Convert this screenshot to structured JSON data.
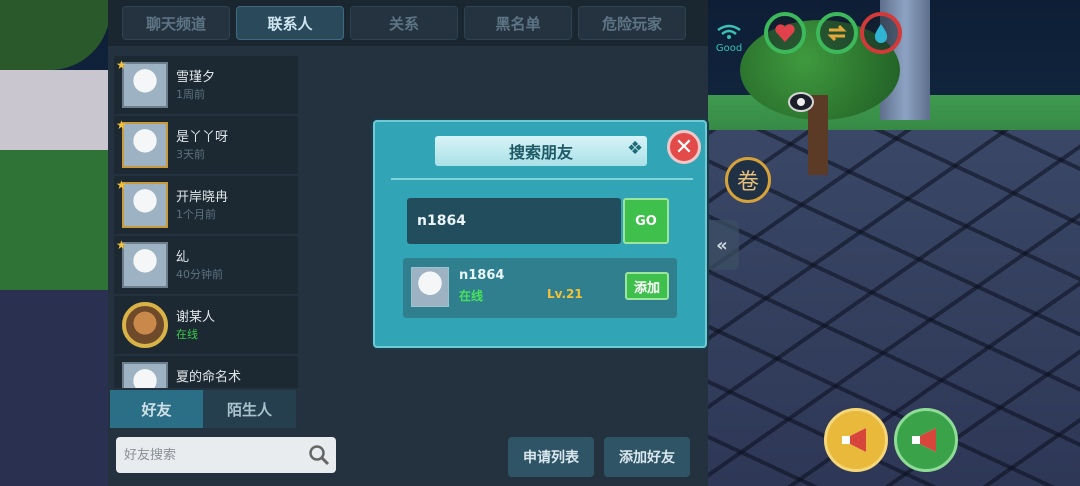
{
  "tabs": [
    {
      "label": "聊天频道",
      "active": false
    },
    {
      "label": "联系人",
      "active": true
    },
    {
      "label": "关系",
      "active": false
    },
    {
      "label": "黑名单",
      "active": false
    },
    {
      "label": "危险玩家",
      "active": false
    }
  ],
  "contacts": [
    {
      "name": "雪瑾夕",
      "status": "1周前",
      "online": false
    },
    {
      "name": "是丫丫呀",
      "status": "3天前",
      "online": false
    },
    {
      "name": "开岸晓冉",
      "status": "1个月前",
      "online": false
    },
    {
      "name": "乣",
      "status": "40分钟前",
      "online": false
    },
    {
      "name": "谢某人",
      "status": "在线",
      "online": true
    },
    {
      "name": "夏的命名术",
      "status": "",
      "online": false
    }
  ],
  "bottom_tabs": {
    "friends": "好友",
    "strangers": "陌生人"
  },
  "friend_search": {
    "placeholder": "好友搜索"
  },
  "actions": {
    "apply_list": "申请列表",
    "add_friend": "添加好友"
  },
  "dialog": {
    "title": "搜索朋友",
    "close": "✕",
    "query": "n1864",
    "go_label": "GO",
    "result": {
      "name": "n1864",
      "status": "在线",
      "level": "Lv.21",
      "add_label": "添加"
    }
  },
  "hud": {
    "wifi_label": "Good",
    "collapse": "«",
    "scroll_glyph": "卷",
    "icons": [
      "heart-icon",
      "swap-arrows-icon",
      "water-drop-icon",
      "eye-icon",
      "horn-icon",
      "megaphone-icon"
    ]
  },
  "colors": {
    "accent": "#31a5b6",
    "online": "#3ec94c",
    "level": "#f3c23a",
    "danger": "#e34b4b"
  }
}
